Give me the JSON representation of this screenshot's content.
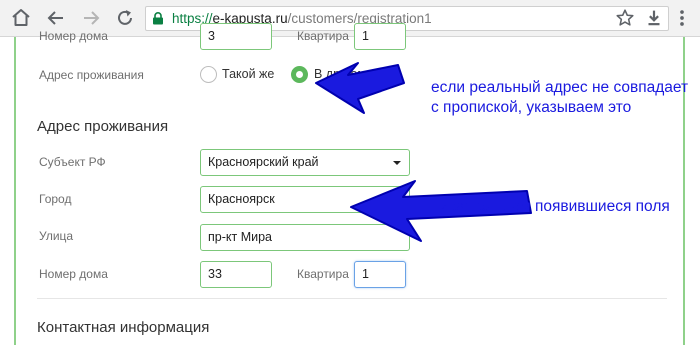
{
  "browser": {
    "url_scheme": "https://",
    "url_host": "e-kapusta.ru",
    "url_path": "/customers/registration1"
  },
  "form": {
    "top_partial": {
      "house_label": "Номер дома",
      "house_value": "3",
      "apt_label": "Квартира",
      "apt_value": "1"
    },
    "residence_choice": {
      "label": "Адрес проживания",
      "option_same": "Такой же",
      "option_other": "В другом"
    },
    "residence_section": {
      "title": "Адрес проживания",
      "region_label": "Субъект РФ",
      "region_value": "Красноярский край",
      "city_label": "Город",
      "city_value": "Красноярск",
      "street_label": "Улица",
      "street_value": "пр-кт Мира",
      "house_label": "Номер дома",
      "house_value": "33",
      "apt_label": "Квартира",
      "apt_value": "1"
    },
    "contact_section": {
      "title": "Контактная информация"
    }
  },
  "annotations": {
    "note_line1": "если реальный адрес не совпадает",
    "note_line2": "с пропиской, указываем это",
    "note_fill": "и заполняем появившиеся поля",
    "color": "#1a1adf"
  },
  "colors": {
    "field_border": "#7cc77a",
    "radio_checked": "#5cb85c",
    "focus_border": "#6aa2e6",
    "page_side_border": "#8fd18a"
  }
}
